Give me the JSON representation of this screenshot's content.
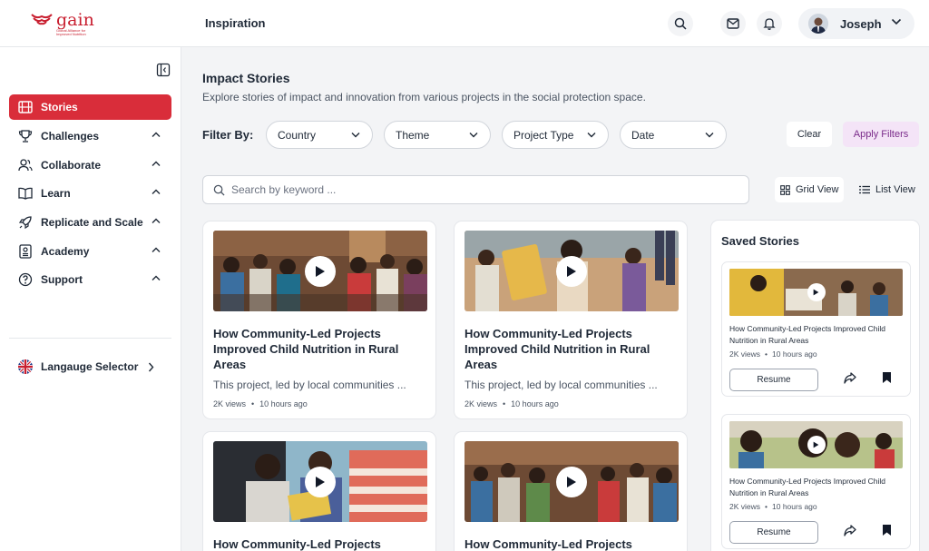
{
  "header": {
    "logo_text": "gain",
    "logo_tagline": "Global Alliance for Improved Nutrition",
    "title": "Inspiration",
    "user_name": "Joseph"
  },
  "sidebar": {
    "items": [
      {
        "label": "Stories",
        "icon": "film-icon",
        "active": true
      },
      {
        "label": "Challenges",
        "icon": "trophy-icon",
        "chevron": "up"
      },
      {
        "label": "Collaborate",
        "icon": "users-icon",
        "chevron": "up"
      },
      {
        "label": "Learn",
        "icon": "book-icon",
        "chevron": "up"
      },
      {
        "label": "Replicate and Scale",
        "icon": "rocket-icon",
        "chevron": "up"
      },
      {
        "label": "Academy",
        "icon": "academy-icon",
        "chevron": "up"
      },
      {
        "label": "Support",
        "icon": "help-icon",
        "chevron": "up"
      }
    ],
    "language_label": "Langauge Selector"
  },
  "main": {
    "title": "Impact Stories",
    "subtitle": "Explore stories of impact and innovation from various projects in the social protection space.",
    "filter_label": "Filter By:",
    "filters": [
      "Country",
      "Theme",
      "Project Type",
      "Date"
    ],
    "clear_label": "Clear",
    "apply_label": "Apply Filters",
    "search_placeholder": "Search by keyword ...",
    "views": {
      "grid": "Grid View",
      "list": "List View",
      "active": "grid"
    }
  },
  "stories": [
    {
      "title": "How Community-Led Projects Improved Child Nutrition in Rural Areas",
      "desc": "This project, led by local communities ...",
      "views": "2K views",
      "time": "10 hours ago"
    },
    {
      "title": "How Community-Led Projects Improved Child Nutrition in Rural Areas",
      "desc": "This project, led by local communities ...",
      "views": "2K views",
      "time": "10 hours ago"
    },
    {
      "title": "How Community-Led Projects",
      "desc": "",
      "views": "",
      "time": ""
    },
    {
      "title": "How Community-Led Projects",
      "desc": "",
      "views": "",
      "time": ""
    }
  ],
  "saved": {
    "title": "Saved Stories",
    "items": [
      {
        "title": "How Community-Led Projects Improved Child Nutrition in Rural Areas",
        "views": "2K views",
        "time": "10 hours ago",
        "resume_label": "Resume"
      },
      {
        "title": "How Community-Led Projects Improved Child Nutrition in Rural Areas",
        "views": "2K views",
        "time": "10 hours ago",
        "resume_label": "Resume"
      }
    ]
  },
  "colors": {
    "accent": "#d92d3a",
    "apply_bg": "#f4e4f7",
    "apply_text": "#7a2b8a",
    "brand": "#c81e2f"
  }
}
